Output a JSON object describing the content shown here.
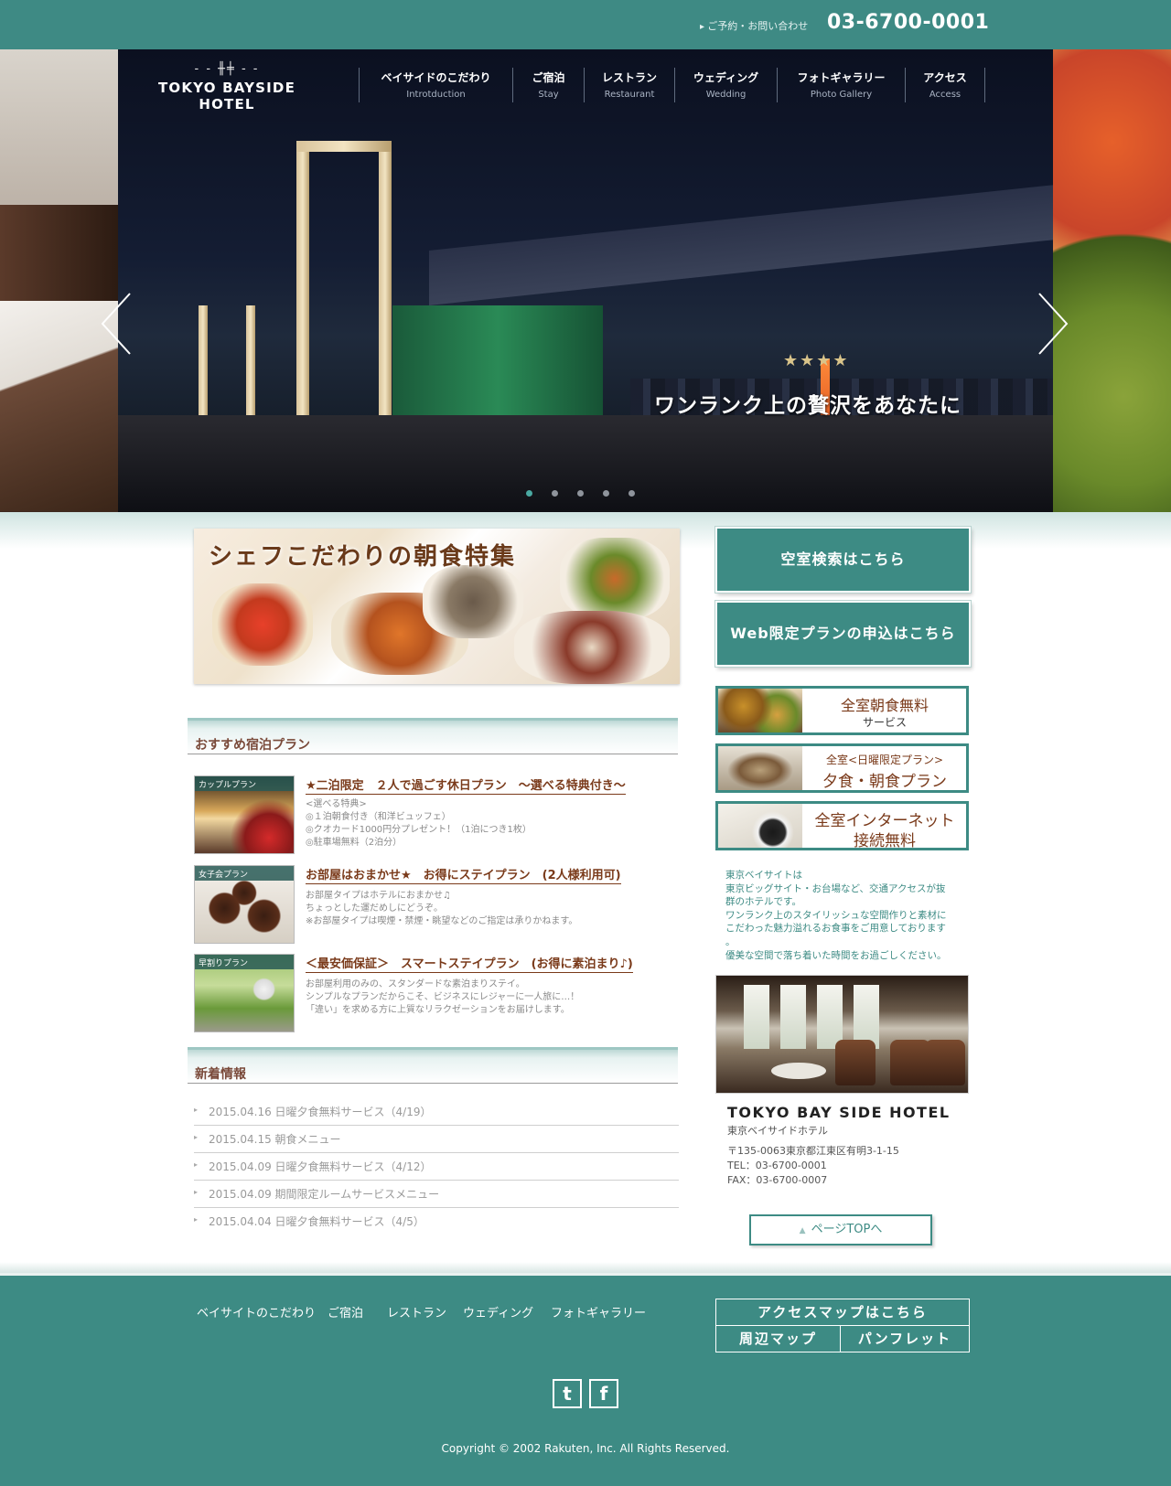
{
  "header": {
    "contact_label": "ご予約・お問い合わせ",
    "phone": "03-6700-0001"
  },
  "logo": {
    "mark": "- - ╫╪ - -",
    "name": "TOKYO BAYSIDE HOTEL"
  },
  "nav": [
    {
      "jp": "ベイサイドのこだわり",
      "en": "Introtduction"
    },
    {
      "jp": "ご宿泊",
      "en": "Stay"
    },
    {
      "jp": "レストラン",
      "en": "Restaurant"
    },
    {
      "jp": "ウェディング",
      "en": "Wedding"
    },
    {
      "jp": "フォトギャラリー",
      "en": "Photo Gallery"
    },
    {
      "jp": "アクセス",
      "en": "Access"
    }
  ],
  "slider": {
    "stars": "★★★★",
    "caption": "ワンランク上の贅沢をあなたに",
    "slide_count": 5,
    "active_index": 0,
    "prev_icon": "chevron-left-icon",
    "next_icon": "chevron-right-icon"
  },
  "promo": {
    "title": "シェフこだわりの朝食特集"
  },
  "plans_section": {
    "heading": "おすすめ宿泊プラン",
    "plans": [
      {
        "tag": "カップルプラン",
        "title": "★二泊限定　２人で過ごす休日プラン　～選べる特典付き～",
        "lines": [
          "<選べる特典>",
          "◎１泊朝食付き（和洋ビュッフェ）",
          "◎クオカード1000円分プレゼント！（1泊につき1枚）",
          "◎駐車場無料（2泊分）"
        ]
      },
      {
        "tag": "女子会プラン",
        "title": "お部屋はおまかせ★　お得にステイプラン　(2人様利用可)",
        "lines": [
          "お部屋タイプはホテルにおまかせ♫",
          "ちょっとした運だめしにどうぞ。",
          "※お部屋タイプは喫煙・禁煙・眺望などのご指定は承りかねます。"
        ]
      },
      {
        "tag": "早割りプラン",
        "title": "＜最安価保証＞　スマートステイプラン　(お得に素泊まり♪)",
        "lines": [
          "お部屋利用のみの、スタンダードな素泊まりステイ。",
          "シンプルなプランだからこそ、ビジネスにレジャーに一人旅に…！",
          "「違い」を求める方に上質なリラクゼーションをお届けします。"
        ]
      }
    ]
  },
  "news_section": {
    "heading": "新着情報",
    "items": [
      "2015.04.16 日曜夕食無料サービス（4/19）",
      "2015.04.15 朝食メニュー",
      "2015.04.09 日曜夕食無料サービス（4/12）",
      "2015.04.09 期間限定ルームサービスメニュー",
      "2015.04.04 日曜夕食無料サービス（4/5）"
    ]
  },
  "sidebar": {
    "search_button": "空室検索はこちら",
    "web_plan_button": "Web限定プランの申込はこちら",
    "banners": [
      {
        "line1": "全室朝食無料",
        "line2": "サービス"
      },
      {
        "line1": "全室<日曜限定プラン>",
        "line2": "夕食・朝食プラン"
      },
      {
        "line1": "全室インターネット",
        "line2": "接続無料"
      }
    ],
    "intro": [
      "東京ベイサイトは",
      "東京ビッグサイト・お台場など、交通アクセスが抜",
      "群のホテルです。",
      "ワンランク上のスタイリッシュな空間作りと素材に",
      "こだわった魅力溢れるお食事をご用意しております",
      "。",
      "優美な空間で落ち着いた時間をお過ごしください。"
    ],
    "hotel_name": "TOKYO BAY SIDE HOTEL",
    "hotel_name_jp": "東京ベイサイドホテル",
    "address": "〒135-0063東京都江東区有明3-1-15",
    "tel": "TEL：03-6700-0001",
    "fax": "FAX：03-6700-0007",
    "pagetop": "ページTOPへ"
  },
  "footer": {
    "links": [
      "ベイサイトのこだわり",
      "ご宿泊",
      "レストラン",
      "ウェディング",
      "フォトギャラリー"
    ],
    "access_map": "アクセスマップはこちら",
    "area_map": "周辺マップ",
    "pamphlet": "パンフレット",
    "social": [
      {
        "icon": "twitter-icon",
        "glyph": "t"
      },
      {
        "icon": "facebook-icon",
        "glyph": "f"
      }
    ],
    "copyright": "Copyright © 2002 Rakuten, Inc. All Rights Reserved."
  },
  "colors": {
    "teal": "#3d8b84",
    "brown": "#7a3a1a"
  }
}
